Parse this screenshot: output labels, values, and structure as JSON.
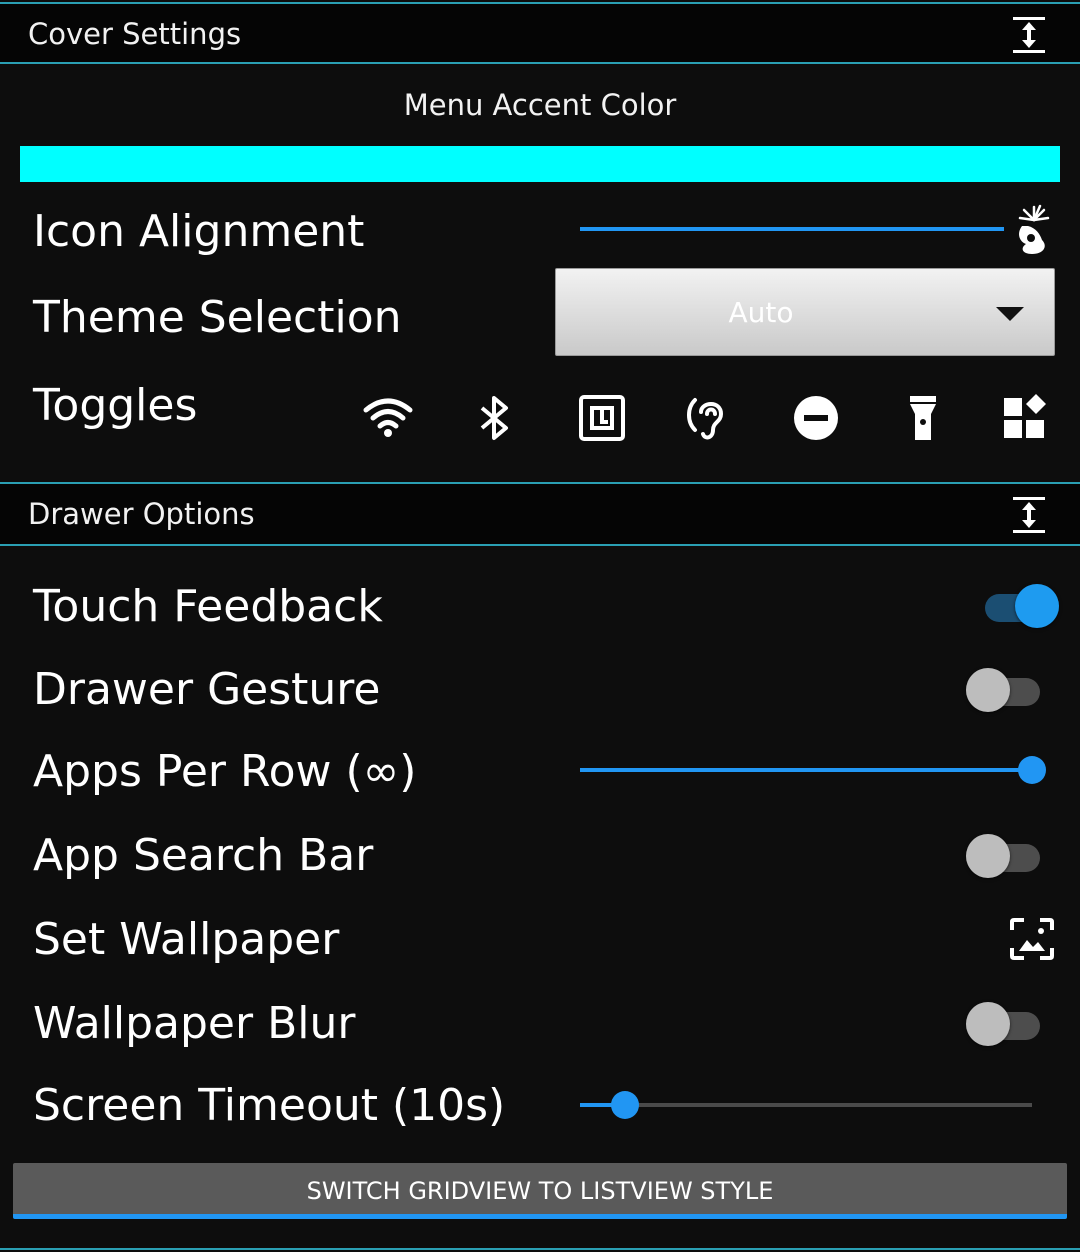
{
  "cover_settings": {
    "title": "Cover Settings",
    "menu_accent_label": "Menu Accent Color",
    "accent_color": "#00ffff",
    "icon_alignment": {
      "label": "Icon Alignment",
      "value": 1.0
    },
    "theme_selection": {
      "label": "Theme Selection",
      "value": "Auto"
    },
    "toggles": {
      "label": "Toggles",
      "icons": [
        "wifi-icon",
        "bluetooth-icon",
        "nfc-icon",
        "hearing-icon",
        "do-not-disturb-icon",
        "flashlight-icon",
        "widgets-icon"
      ]
    }
  },
  "drawer_options": {
    "title": "Drawer Options",
    "touch_feedback": {
      "label": "Touch Feedback",
      "on": true
    },
    "drawer_gesture": {
      "label": "Drawer Gesture",
      "on": false
    },
    "apps_per_row": {
      "label": "Apps Per Row (∞)",
      "value": 1.0
    },
    "app_search_bar": {
      "label": "App Search Bar",
      "on": false
    },
    "set_wallpaper": {
      "label": "Set Wallpaper",
      "icon": "wallpaper-icon"
    },
    "wallpaper_blur": {
      "label": "Wallpaper Blur",
      "on": false
    },
    "screen_timeout": {
      "label": "Screen Timeout (10s)",
      "value": 0.1
    },
    "switch_button": "SWITCH GRIDVIEW TO LISTVIEW STYLE"
  },
  "colors": {
    "accent": "#2196f3",
    "header_border": "#2a9fb3"
  }
}
